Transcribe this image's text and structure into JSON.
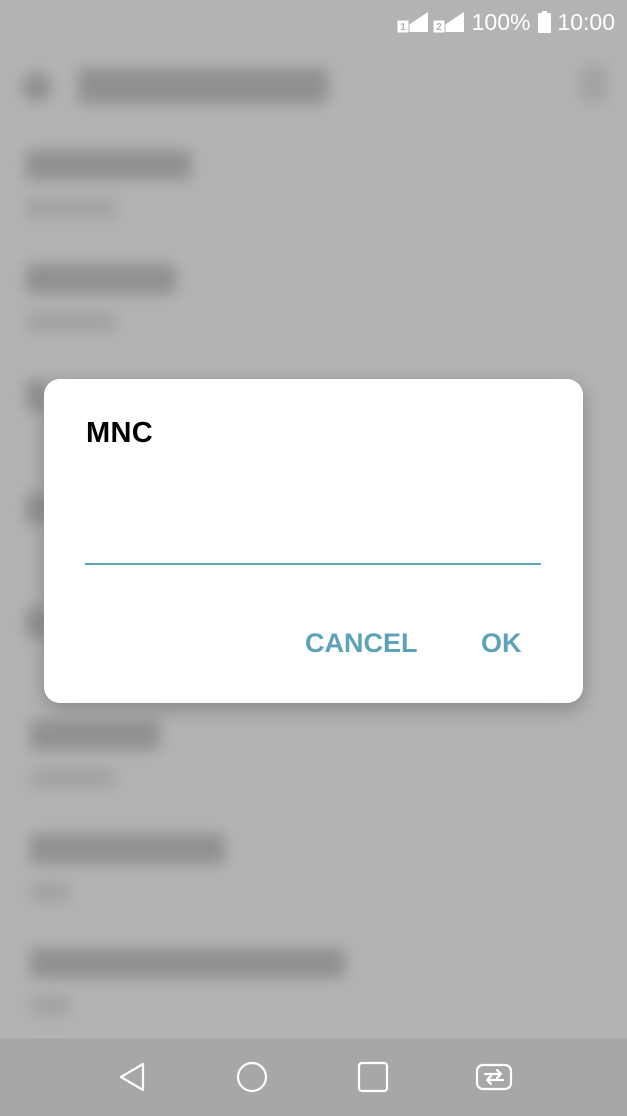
{
  "status_bar": {
    "battery": "100%",
    "time": "10:00",
    "sim1": "1",
    "sim2": "2"
  },
  "dialog": {
    "title": "MNC",
    "input_value": "",
    "cancel_label": "CANCEL",
    "ok_label": "OK"
  },
  "colors": {
    "accent": "#5ca3b8",
    "scrim": "#b3b3b3",
    "nav_bar": "#a7a7a7"
  },
  "nav_bar": {
    "icons": [
      "back-icon",
      "home-icon",
      "recents-icon",
      "dual-window-icon"
    ]
  }
}
